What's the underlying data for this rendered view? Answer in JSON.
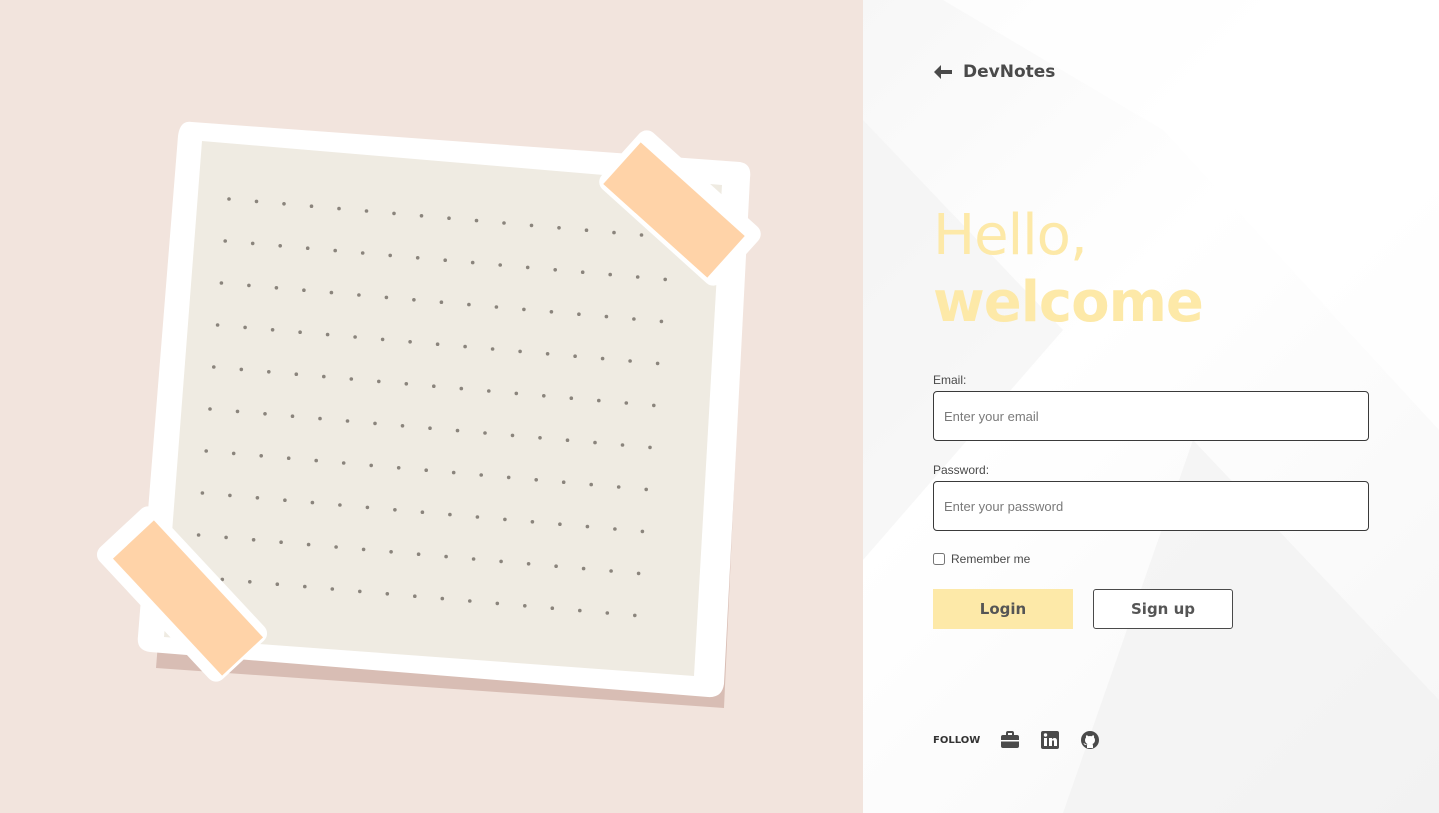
{
  "brand": {
    "name": "DevNotes",
    "icon": "arrow-left-icon"
  },
  "heading": {
    "line1": "Hello,",
    "line2": "welcome"
  },
  "form": {
    "email_label": "Email:",
    "email_placeholder": "Enter your email",
    "email_value": "",
    "password_label": "Password:",
    "password_placeholder": "Enter your password",
    "password_value": "",
    "remember_label": "Remember me",
    "remember_checked": false
  },
  "actions": {
    "login_label": "Login",
    "signup_label": "Sign up"
  },
  "follow": {
    "label": "FOLLOW",
    "icons": [
      "briefcase-icon",
      "linkedin-icon",
      "github-icon"
    ]
  },
  "colors": {
    "left_bg": "#f2e4dd",
    "accent_yellow": "#fde9a8",
    "note_paper": "#efebe2",
    "tape": "#ffd3a8",
    "text_dark": "#4a4a4a"
  }
}
